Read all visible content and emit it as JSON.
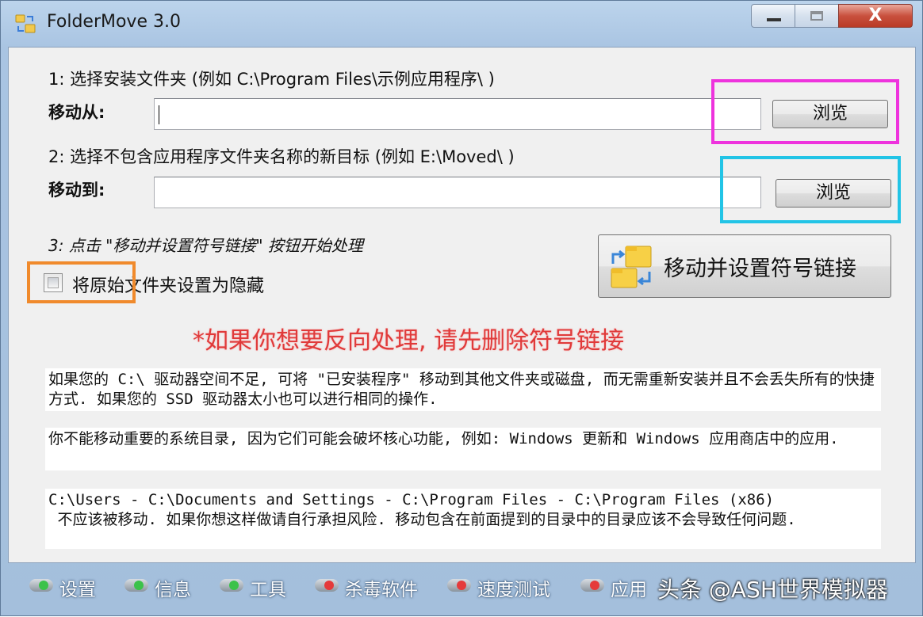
{
  "window": {
    "title": "FolderMove 3.0",
    "close_glyph": "X"
  },
  "step1": {
    "instruction": "1: 选择安装文件夹 (例如 C:\\Program Files\\示例应用程序\\ )",
    "label": "移动从:",
    "value": "",
    "browse_label": "浏览"
  },
  "step2": {
    "instruction": "2: 选择不包含应用程序文件夹名称的新目标 (例如 E:\\Moved\\ )",
    "label": "移动到:",
    "value": "",
    "browse_label": "浏览"
  },
  "step3": {
    "instruction": "3: 点击 \"移动并设置符号链接\" 按钮开始处理",
    "checkbox_label": "将原始文件夹设置为隐藏",
    "checkbox_checked": false,
    "move_button_label": "移动并设置符号链接"
  },
  "warning": "*如果你想要反向处理, 请先删除符号链接",
  "paragraphs": [
    "如果您的 C:\\ 驱动器空间不足, 可将 \"已安装程序\" 移动到其他文件夹或磁盘, 而无需重新安装并且不会丢失所有的快捷方式. 如果您的 SSD 驱动器太小也可以进行相同的操作.",
    "你不能移动重要的系统目录, 因为它们可能会破坏核心功能, 例如: Windows 更新和 Windows 应用商店中的应用.",
    "C:\\Users - C:\\Documents and Settings - C:\\Program Files - C:\\Program Files (x86)\n 不应该被移动. 如果你想这样做请自行承担风险. 移动包含在前面提到的目录中的目录应该不会导致任何问题."
  ],
  "bottom_nav": [
    {
      "label": "设置",
      "led_color": "#3cc24a"
    },
    {
      "label": "信息",
      "led_color": "#3cc24a"
    },
    {
      "label": "工具",
      "led_color": "#3cc24a"
    },
    {
      "label": "杀毒软件",
      "led_color": "#e53a3a"
    },
    {
      "label": "速度测试",
      "led_color": "#e53a3a"
    },
    {
      "label": "应用",
      "led_color": "#e53a3a"
    }
  ],
  "watermark": "头条 @ASH世界模拟器",
  "colors": {
    "highlight_browse_from": "#ee33dd",
    "highlight_browse_to": "#22c4e6",
    "highlight_checkbox": "#f08a2c",
    "warning_text": "#e03a3a"
  }
}
